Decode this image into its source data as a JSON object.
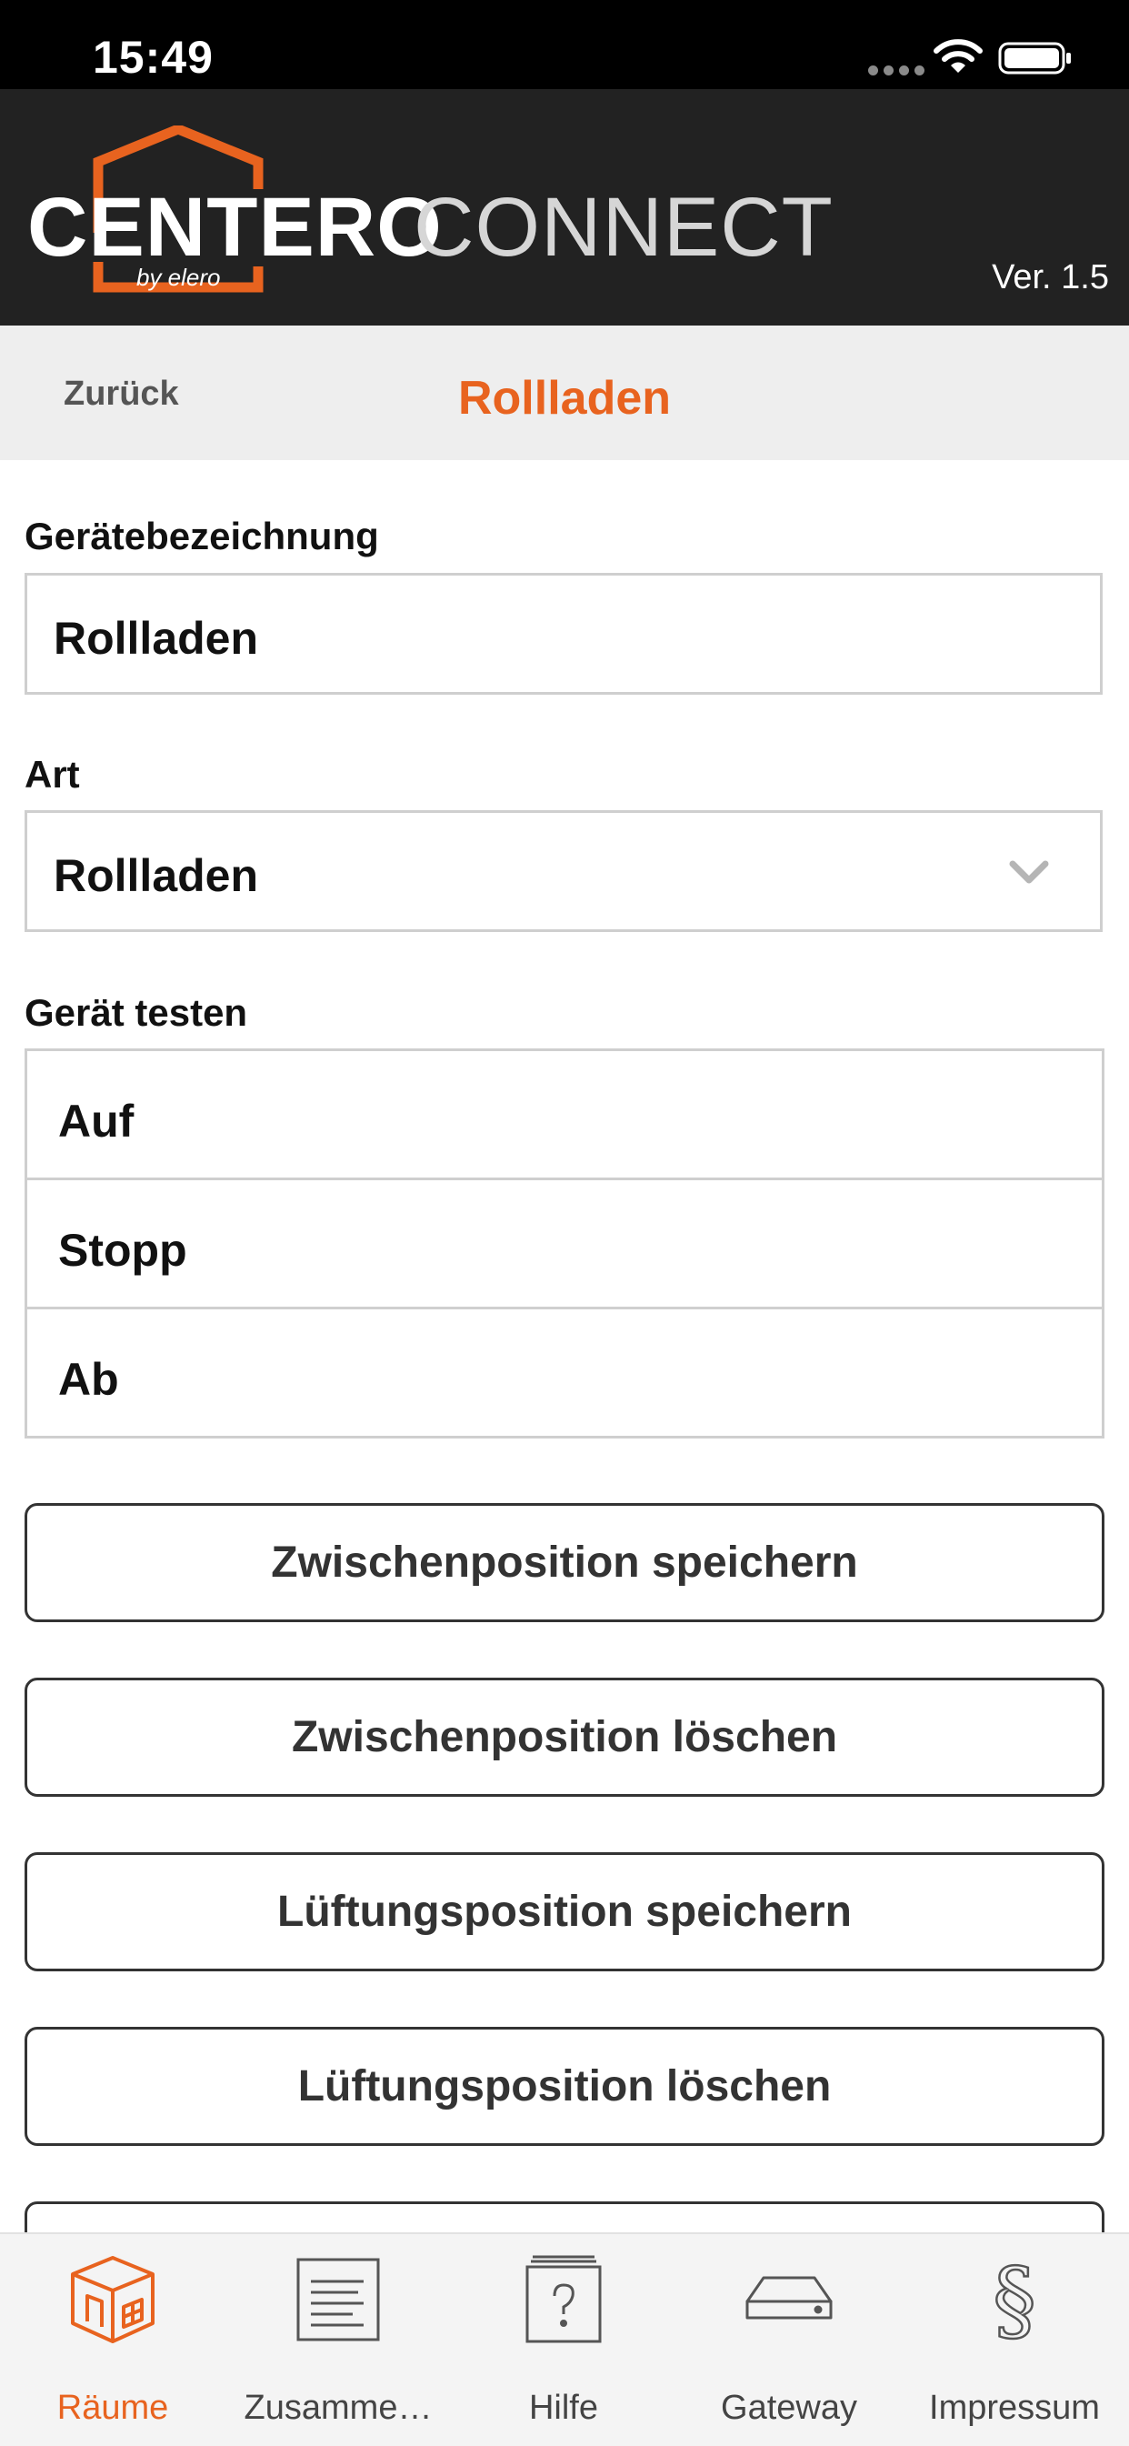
{
  "status_bar": {
    "time": "15:49"
  },
  "header": {
    "logo_primary": "CENTERO",
    "logo_secondary": "CONNECT",
    "logo_by": "by elero",
    "version": "Ver. 1.5",
    "accent_color": "#e8631f"
  },
  "nav": {
    "back_label": "Zurück",
    "title": "Rollladen"
  },
  "form": {
    "device_name_label": "Gerätebezeichnung",
    "device_name_value": "Rollladen",
    "type_label": "Art",
    "type_value": "Rollladen",
    "test_label": "Gerät testen",
    "test_rows": [
      "Auf",
      "Stopp",
      "Ab"
    ]
  },
  "actions": {
    "save_intermediate": "Zwischenposition speichern",
    "delete_intermediate": "Zwischenposition löschen",
    "save_ventilation": "Lüftungsposition speichern",
    "delete_ventilation": "Lüftungsposition löschen"
  },
  "tabs": [
    {
      "label": "Räume",
      "icon": "rooms-icon",
      "active": true
    },
    {
      "label": "Zusamme…",
      "icon": "summary-icon",
      "active": false
    },
    {
      "label": "Hilfe",
      "icon": "help-icon",
      "active": false
    },
    {
      "label": "Gateway",
      "icon": "gateway-icon",
      "active": false
    },
    {
      "label": "Impressum",
      "icon": "impressum-icon",
      "active": false
    }
  ]
}
